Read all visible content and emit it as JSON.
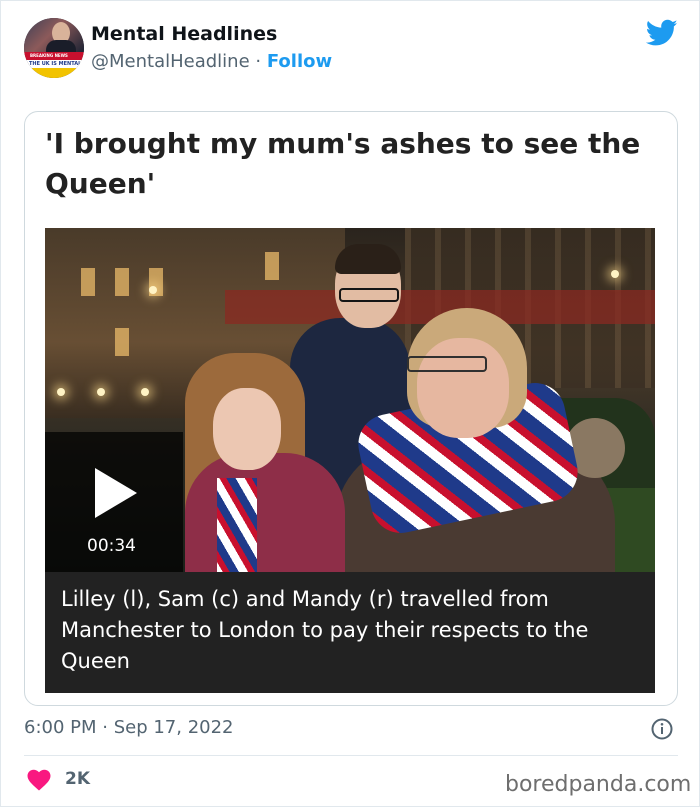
{
  "author": {
    "name": "Mental Headlines",
    "handle": "@MentalHeadline",
    "separator": "·",
    "follow_label": "Follow",
    "avatar_text_top": "BREAKING NEWS",
    "avatar_text_bottom": "THE UK IS MENTAL"
  },
  "embed": {
    "headline": "'I brought my mum's ashes to see the Queen'",
    "video": {
      "duration": "00:34",
      "caption": "Lilley (l), Sam (c) and Mandy (r) travelled from Manchester to London to pay their respects to the Queen"
    }
  },
  "footer": {
    "timestamp": "6:00 PM · Sep 17, 2022",
    "like_count": "2K"
  },
  "watermark": "boredpanda.com",
  "colors": {
    "accent": "#1d9bf0",
    "heart": "#f91880",
    "caption_bg": "#222222",
    "muted_text": "#536471"
  },
  "icons": {
    "brand": "twitter-bird-icon",
    "play": "play-icon",
    "info": "info-icon",
    "like": "heart-icon"
  }
}
